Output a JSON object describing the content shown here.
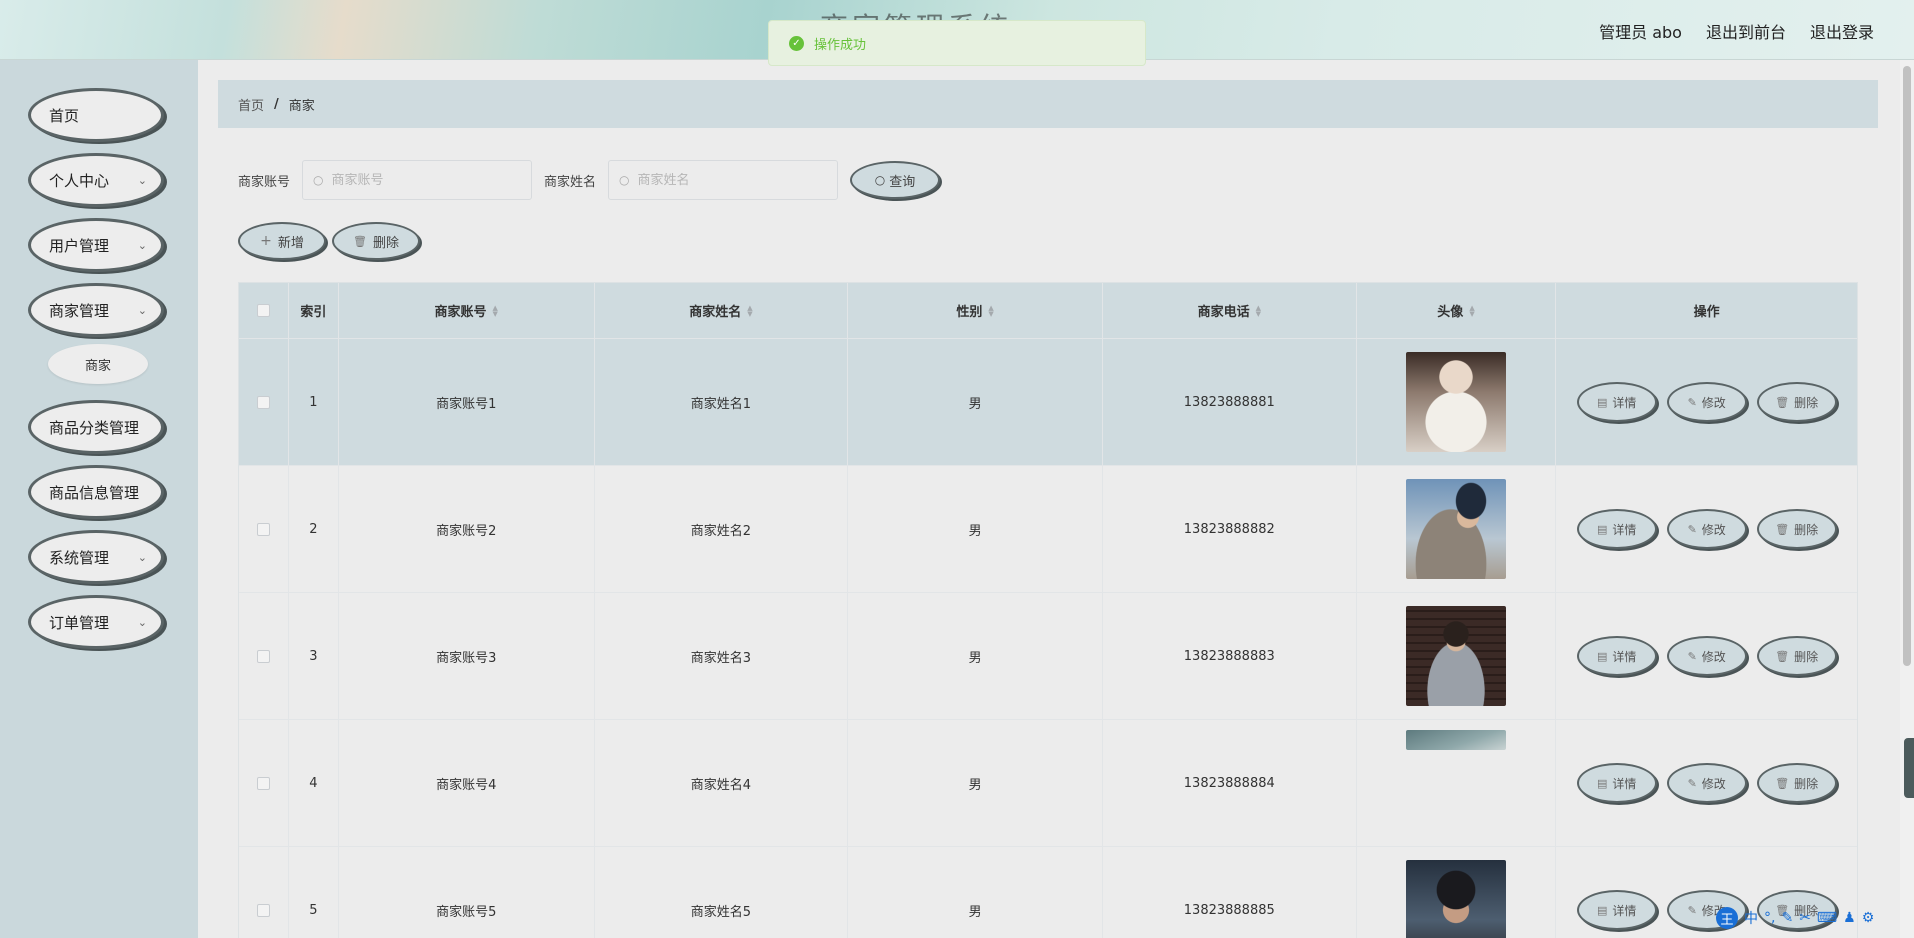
{
  "header": {
    "title": "商家管理系统",
    "user_label": "管理员 abo",
    "back_to_front": "退出到前台",
    "logout": "退出登录"
  },
  "toast": {
    "message": "操作成功",
    "icon": "check-circle-icon"
  },
  "sidebar": {
    "items": [
      {
        "label": "首页",
        "has_submenu": false
      },
      {
        "label": "个人中心",
        "has_submenu": true
      },
      {
        "label": "用户管理",
        "has_submenu": true
      },
      {
        "label": "商家管理",
        "has_submenu": true
      },
      {
        "label": "商品分类管理",
        "has_submenu": false
      },
      {
        "label": "商品信息管理",
        "has_submenu": false
      },
      {
        "label": "系统管理",
        "has_submenu": true
      },
      {
        "label": "订单管理",
        "has_submenu": true
      }
    ],
    "submenu": {
      "label": "商家"
    }
  },
  "breadcrumb": {
    "home": "首页",
    "separator": "/",
    "current": "商家"
  },
  "search": {
    "account_label": "商家账号",
    "account_placeholder": "商家账号",
    "name_label": "商家姓名",
    "name_placeholder": "商家姓名",
    "query_button": "查询"
  },
  "actions": {
    "add": "新增",
    "delete": "删除"
  },
  "table": {
    "headers": {
      "index": "索引",
      "account": "商家账号",
      "name": "商家姓名",
      "gender": "性别",
      "phone": "商家电话",
      "avatar": "头像",
      "operation": "操作"
    },
    "rows": [
      {
        "index": "1",
        "account": "商家账号1",
        "name": "商家姓名1",
        "gender": "男",
        "phone": "13823888881"
      },
      {
        "index": "2",
        "account": "商家账号2",
        "name": "商家姓名2",
        "gender": "男",
        "phone": "13823888882"
      },
      {
        "index": "3",
        "account": "商家账号3",
        "name": "商家姓名3",
        "gender": "男",
        "phone": "13823888883"
      },
      {
        "index": "4",
        "account": "商家账号4",
        "name": "商家姓名4",
        "gender": "男",
        "phone": "13823888884"
      },
      {
        "index": "5",
        "account": "商家账号5",
        "name": "商家姓名5",
        "gender": "男",
        "phone": "13823888885"
      }
    ],
    "row_actions": {
      "detail": "详情",
      "edit": "修改",
      "delete": "删除"
    }
  },
  "ime": {
    "logo": "王",
    "mode": "中"
  },
  "colors": {
    "accent": "#cfdbdf",
    "border_dark": "#5a6466",
    "success": "#67c23a"
  }
}
